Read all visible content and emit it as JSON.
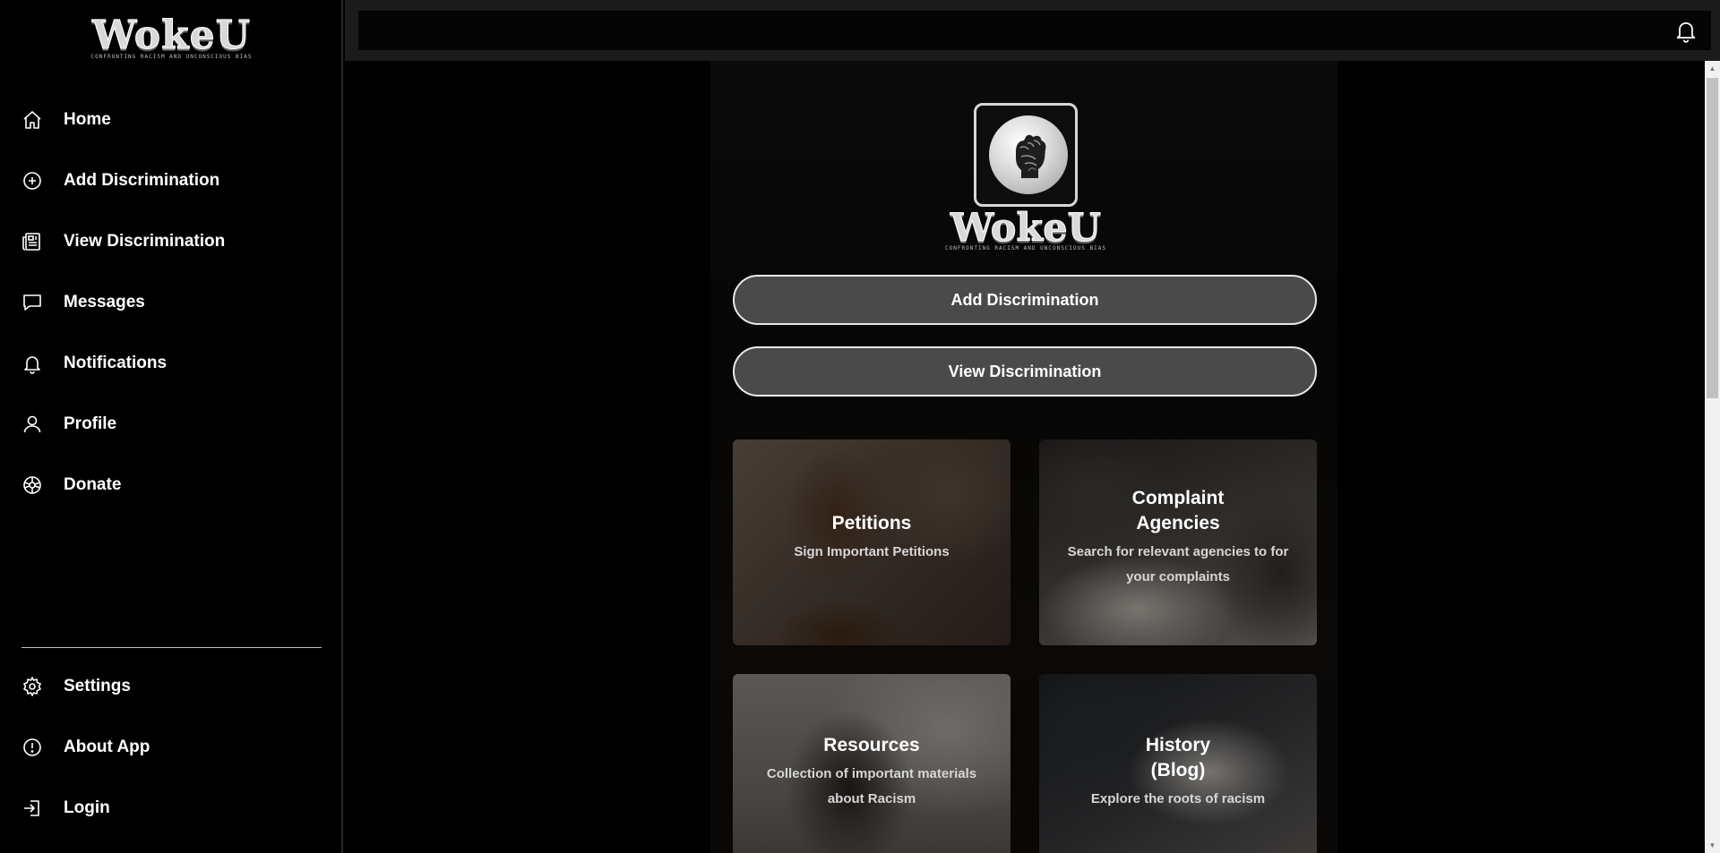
{
  "brand": {
    "name": "WokeU",
    "tagline": "CONFRONTING RACISM AND UNCONSCIOUS BIAS"
  },
  "sidebar": {
    "items": [
      {
        "label": "Home",
        "icon": "home-icon"
      },
      {
        "label": "Add Discrimination",
        "icon": "plus-circle-icon"
      },
      {
        "label": "View Discrimination",
        "icon": "newspaper-icon"
      },
      {
        "label": "Messages",
        "icon": "chat-bubble-icon"
      },
      {
        "label": "Notifications",
        "icon": "bell-icon"
      },
      {
        "label": "Profile",
        "icon": "user-icon"
      },
      {
        "label": "Donate",
        "icon": "donate-icon"
      }
    ],
    "bottom_items": [
      {
        "label": "Settings",
        "icon": "gear-icon"
      },
      {
        "label": "About App",
        "icon": "info-circle-icon"
      },
      {
        "label": "Login",
        "icon": "login-icon"
      }
    ]
  },
  "topbar": {
    "icon": "bell-icon"
  },
  "main": {
    "logo": {
      "name": "WokeU",
      "tagline": "CONFRONTING RACISM AND UNCONSCIOUS BIAS",
      "icon": "raised-fist-icon"
    },
    "buttons": {
      "add": "Add Discrimination",
      "view": "View Discrimination"
    },
    "cards": [
      {
        "title": "Petitions",
        "subtitle": "Sign Important Petitions"
      },
      {
        "title": "Complaint Agencies",
        "subtitle": "Search for relevant agencies to for your complaints"
      },
      {
        "title": "Resources",
        "subtitle": "Collection of important materials about Racism"
      },
      {
        "title": "History (Blog)",
        "subtitle": "Explore the roots of racism"
      }
    ]
  },
  "colors": {
    "background": "#000000",
    "button_fill": "#4a4a4a",
    "button_border": "#e9e9e9",
    "text": "#ffffff"
  }
}
